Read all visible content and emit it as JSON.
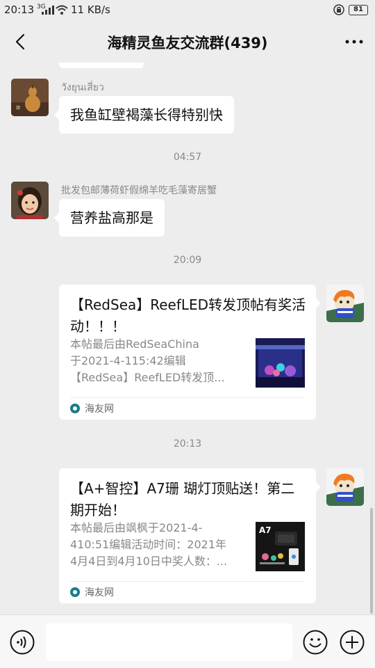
{
  "status_bar": {
    "time": "20:13",
    "network": "3G",
    "net_speed": "11 KB/s",
    "battery": "81"
  },
  "header": {
    "title": "海精灵鱼友交流群(439)",
    "back_icon": "back-arrow-icon",
    "more_icon": "more-dots-icon"
  },
  "messages": [
    {
      "type": "text",
      "sender": "วังยุนเสี่ยว",
      "text": "我鱼缸壁褐藻长得特别快"
    },
    {
      "type": "timestamp",
      "text": "04:57"
    },
    {
      "type": "text",
      "sender": "批发包邮薄荷虾假绵羊吃毛藻寄居蟹",
      "text": "营养盐高那是"
    },
    {
      "type": "timestamp",
      "text": "20:09"
    },
    {
      "type": "link_card",
      "title": "【RedSea】ReefLED转发顶帖有奖活动！！！",
      "description": "本帖最后由RedSeaChina\n于2021-4-115:42编辑\n【RedSea】ReefLED转发顶...",
      "source": "海友网"
    },
    {
      "type": "timestamp",
      "text": "20:13"
    },
    {
      "type": "link_card",
      "title": "【A+智控】A7珊 瑚灯顶贴送！第二期开始！",
      "description": "本帖最后由飒枫于2021-4-\n410:51编辑活动时间：2021年\n4月4日到4月10日中奖人数：...",
      "thumb_text": "A7",
      "source": "海友网"
    }
  ],
  "input_bar": {
    "voice_icon": "voice-icon",
    "emoji_icon": "emoji-icon",
    "plus_icon": "plus-icon"
  },
  "colors": {
    "background": "#ededed",
    "bubble": "#ffffff",
    "meta_text": "#888888",
    "source_icon": "#1a7a8a"
  }
}
